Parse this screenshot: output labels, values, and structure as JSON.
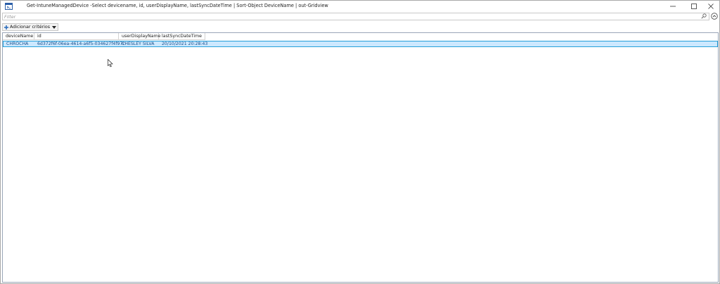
{
  "window": {
    "title": "Get-IntuneManagedDevice -Select devicename, id, userDisplayName, lastSyncDateTime | Sort-Object DeviceName | out-Gridview"
  },
  "filter": {
    "placeholder": "Filter"
  },
  "criteria": {
    "label": "Adicionar critérios"
  },
  "grid": {
    "columns": [
      "deviceName",
      "id",
      "userDisplayName",
      "lastSyncDateTime"
    ],
    "rows": [
      [
        "CHROCHA",
        "6d372f6f-06ea-4614-a6f5-034627f4f97c",
        "CHESLEY SILVA",
        "20/10/2021 20:28:43"
      ]
    ]
  },
  "colors": {
    "selection_bg": "#cce8ff",
    "selection_border": "#26a0da",
    "accent": "#2f6fbd"
  },
  "icons": {
    "app": "powershell-icon",
    "minimize": "minimize-icon",
    "maximize": "maximize-icon",
    "close": "close-icon",
    "search": "search-icon",
    "collapse": "chevron-up-icon",
    "add": "plus-icon",
    "dropdown": "dropdown-arrow-icon"
  }
}
